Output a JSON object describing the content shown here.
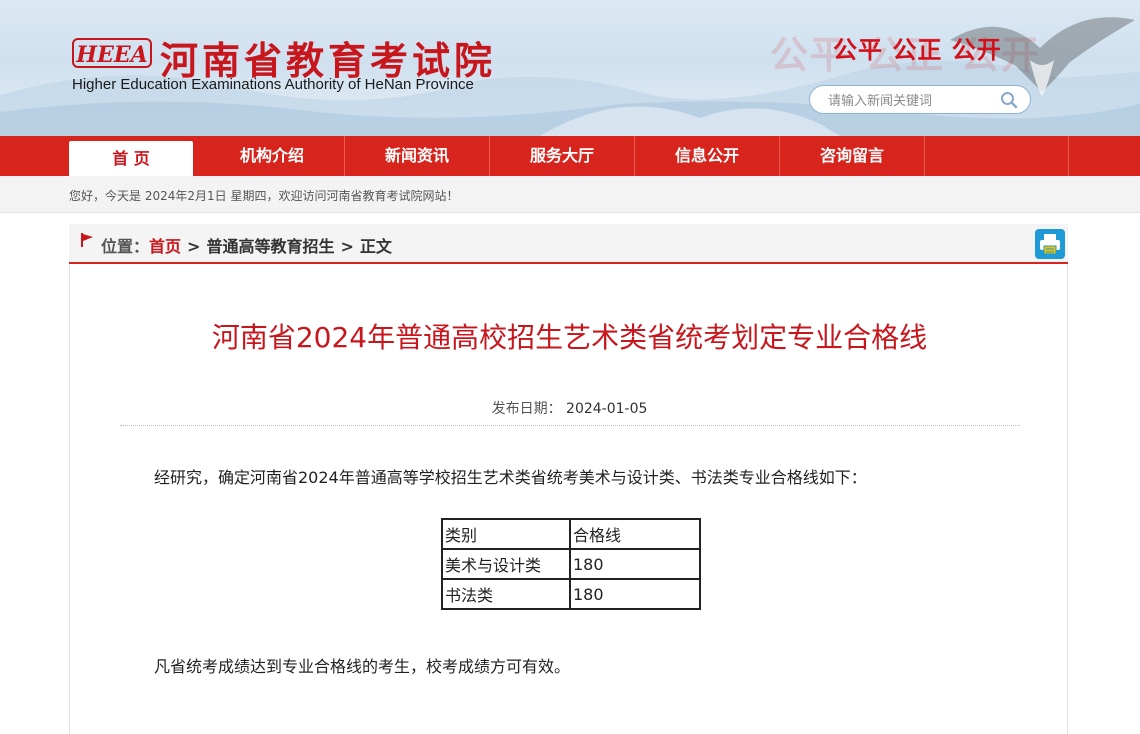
{
  "header": {
    "logo_text": "HEEA",
    "title": "河南省教育考试院",
    "subtitle": "Higher Education Examinations Authority of HeNan Province",
    "slogan": "公平 公正 公开",
    "slogan_shadow": "公平 公正 公开",
    "search_placeholder": "请输入新闻关键词",
    "search_icon": "search-icon"
  },
  "colors": {
    "brand_red": "#d7251e",
    "title_red": "#c8161d",
    "print_blue": "#1e9bd7"
  },
  "nav": {
    "items": [
      {
        "label": "首 页",
        "active": true
      },
      {
        "label": "机构介绍",
        "active": false
      },
      {
        "label": "新闻资讯",
        "active": false
      },
      {
        "label": "服务大厅",
        "active": false
      },
      {
        "label": "信息公开",
        "active": false
      },
      {
        "label": "咨询留言",
        "active": false
      }
    ]
  },
  "welcome": "您好，今天是 2024年2月1日 星期四，欢迎访问河南省教育考试院网站！",
  "breadcrumb": {
    "label": "位置：",
    "home": "首页",
    "separator": ">",
    "section": "普通高等教育招生",
    "current": "正文",
    "print_icon": "printer-icon"
  },
  "article": {
    "title": "河南省2024年普通高校招生艺术类省统考划定专业合格线",
    "date_label": "发布日期：",
    "date": "2024-01-05",
    "paragraph1": "经研究，确定河南省2024年普通高等学校招生艺术类省统考美术与设计类、书法类专业合格线如下：",
    "table": {
      "headers": [
        "类别",
        "合格线"
      ],
      "rows": [
        [
          "美术与设计类",
          "180"
        ],
        [
          "书法类",
          "180"
        ]
      ]
    },
    "paragraph2": "凡省统考成绩达到专业合格线的考生，校考成绩方可有效。"
  }
}
